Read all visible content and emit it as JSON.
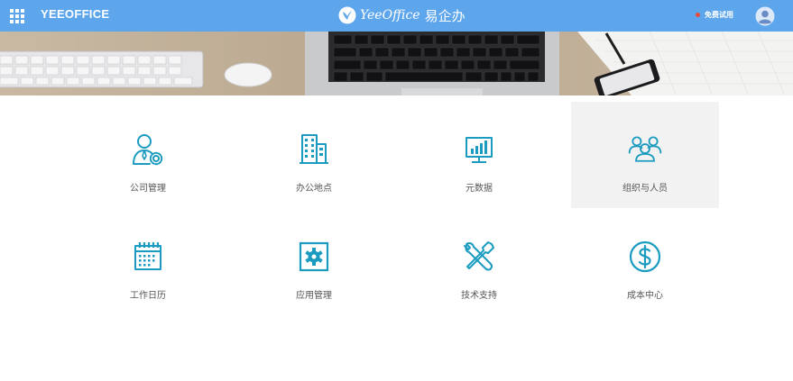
{
  "header": {
    "app_name": "YEEOFFICE",
    "logo_text_en": "YeeOffice",
    "logo_text_cn": "易企办",
    "trial_label": "免费试用",
    "bar_color": "#5ea6ec",
    "trial_dot_color": "#e84b3c"
  },
  "tiles": [
    {
      "label": "公司管理",
      "icon": "company-admin-icon"
    },
    {
      "label": "办公地点",
      "icon": "building-icon"
    },
    {
      "label": "元数据",
      "icon": "metadata-chart-icon"
    },
    {
      "label": "组织与人员",
      "icon": "people-group-icon"
    },
    {
      "label": "工作日历",
      "icon": "calendar-icon"
    },
    {
      "label": "应用管理",
      "icon": "gear-icon"
    },
    {
      "label": "技术支持",
      "icon": "tools-icon"
    },
    {
      "label": "成本中心",
      "icon": "dollar-icon"
    }
  ],
  "accent_color": "#1b9bbf"
}
